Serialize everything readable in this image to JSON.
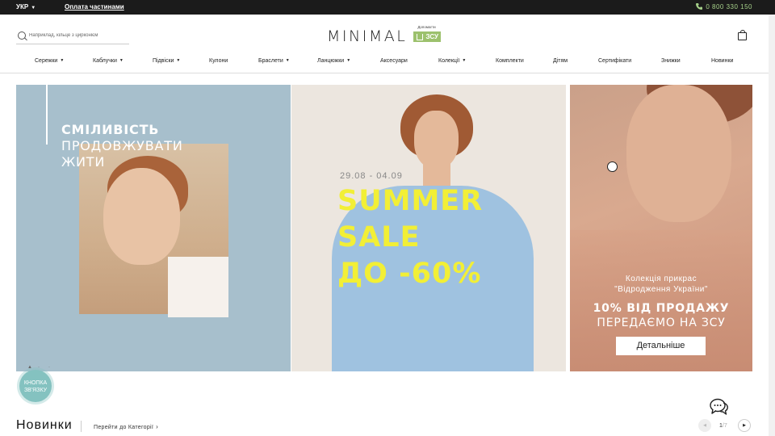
{
  "topbar": {
    "language": "УКР",
    "installments_link": "Оплата частинами",
    "phone": "0 800 330 150"
  },
  "header": {
    "search_placeholder": "Наприклад, кільце з цирконієм",
    "logo": "MINIMAL",
    "support_label": "Допомагти",
    "support_badge": "ЗСУ"
  },
  "nav": {
    "items": [
      {
        "label": "Сережки"
      },
      {
        "label": "Каблучки"
      },
      {
        "label": "Підвіски"
      },
      {
        "label": "Кулони"
      },
      {
        "label": "Браслети"
      },
      {
        "label": "Ланцюжки"
      },
      {
        "label": "Аксесуари"
      },
      {
        "label": "Колекції"
      },
      {
        "label": "Комплекти"
      },
      {
        "label": "Дітям"
      },
      {
        "label": "Сертифікати"
      },
      {
        "label": "Знижки"
      },
      {
        "label": "Новинки"
      }
    ]
  },
  "banners": {
    "banner1": {
      "line1": "СМІЛИВІСТЬ",
      "line2": "ПРОДОВЖУВАТИ",
      "line3": "ЖИТИ"
    },
    "banner2": {
      "dates": "29.08 - 04.09",
      "line1": "SUMMER",
      "line2": "SALE",
      "line3": "ДО -60%"
    },
    "banner3": {
      "collection_line1": "Колекція прикрас",
      "collection_line2": "\"Відродження України\"",
      "headline1": "10% ВІД ПРОДАЖУ",
      "headline2": "ПЕРЕДАЄМО НА ЗСУ",
      "button": "Детальніше"
    }
  },
  "contact_button": {
    "line1": "КНОПКА",
    "line2": "ЗВ'ЯЗКУ"
  },
  "new_section": {
    "title": "Новинки",
    "category_link": "Перейти до Категорії",
    "page_current": "1",
    "page_total": "7"
  },
  "colors": {
    "topbar_bg": "#1b1b1b",
    "phone": "#a6d18a",
    "sale_yellow": "#f2ef36",
    "banner1_bg": "#a7bfcc",
    "contact_button": "#84c2c0",
    "zsu_badge": "#9cc16d"
  }
}
